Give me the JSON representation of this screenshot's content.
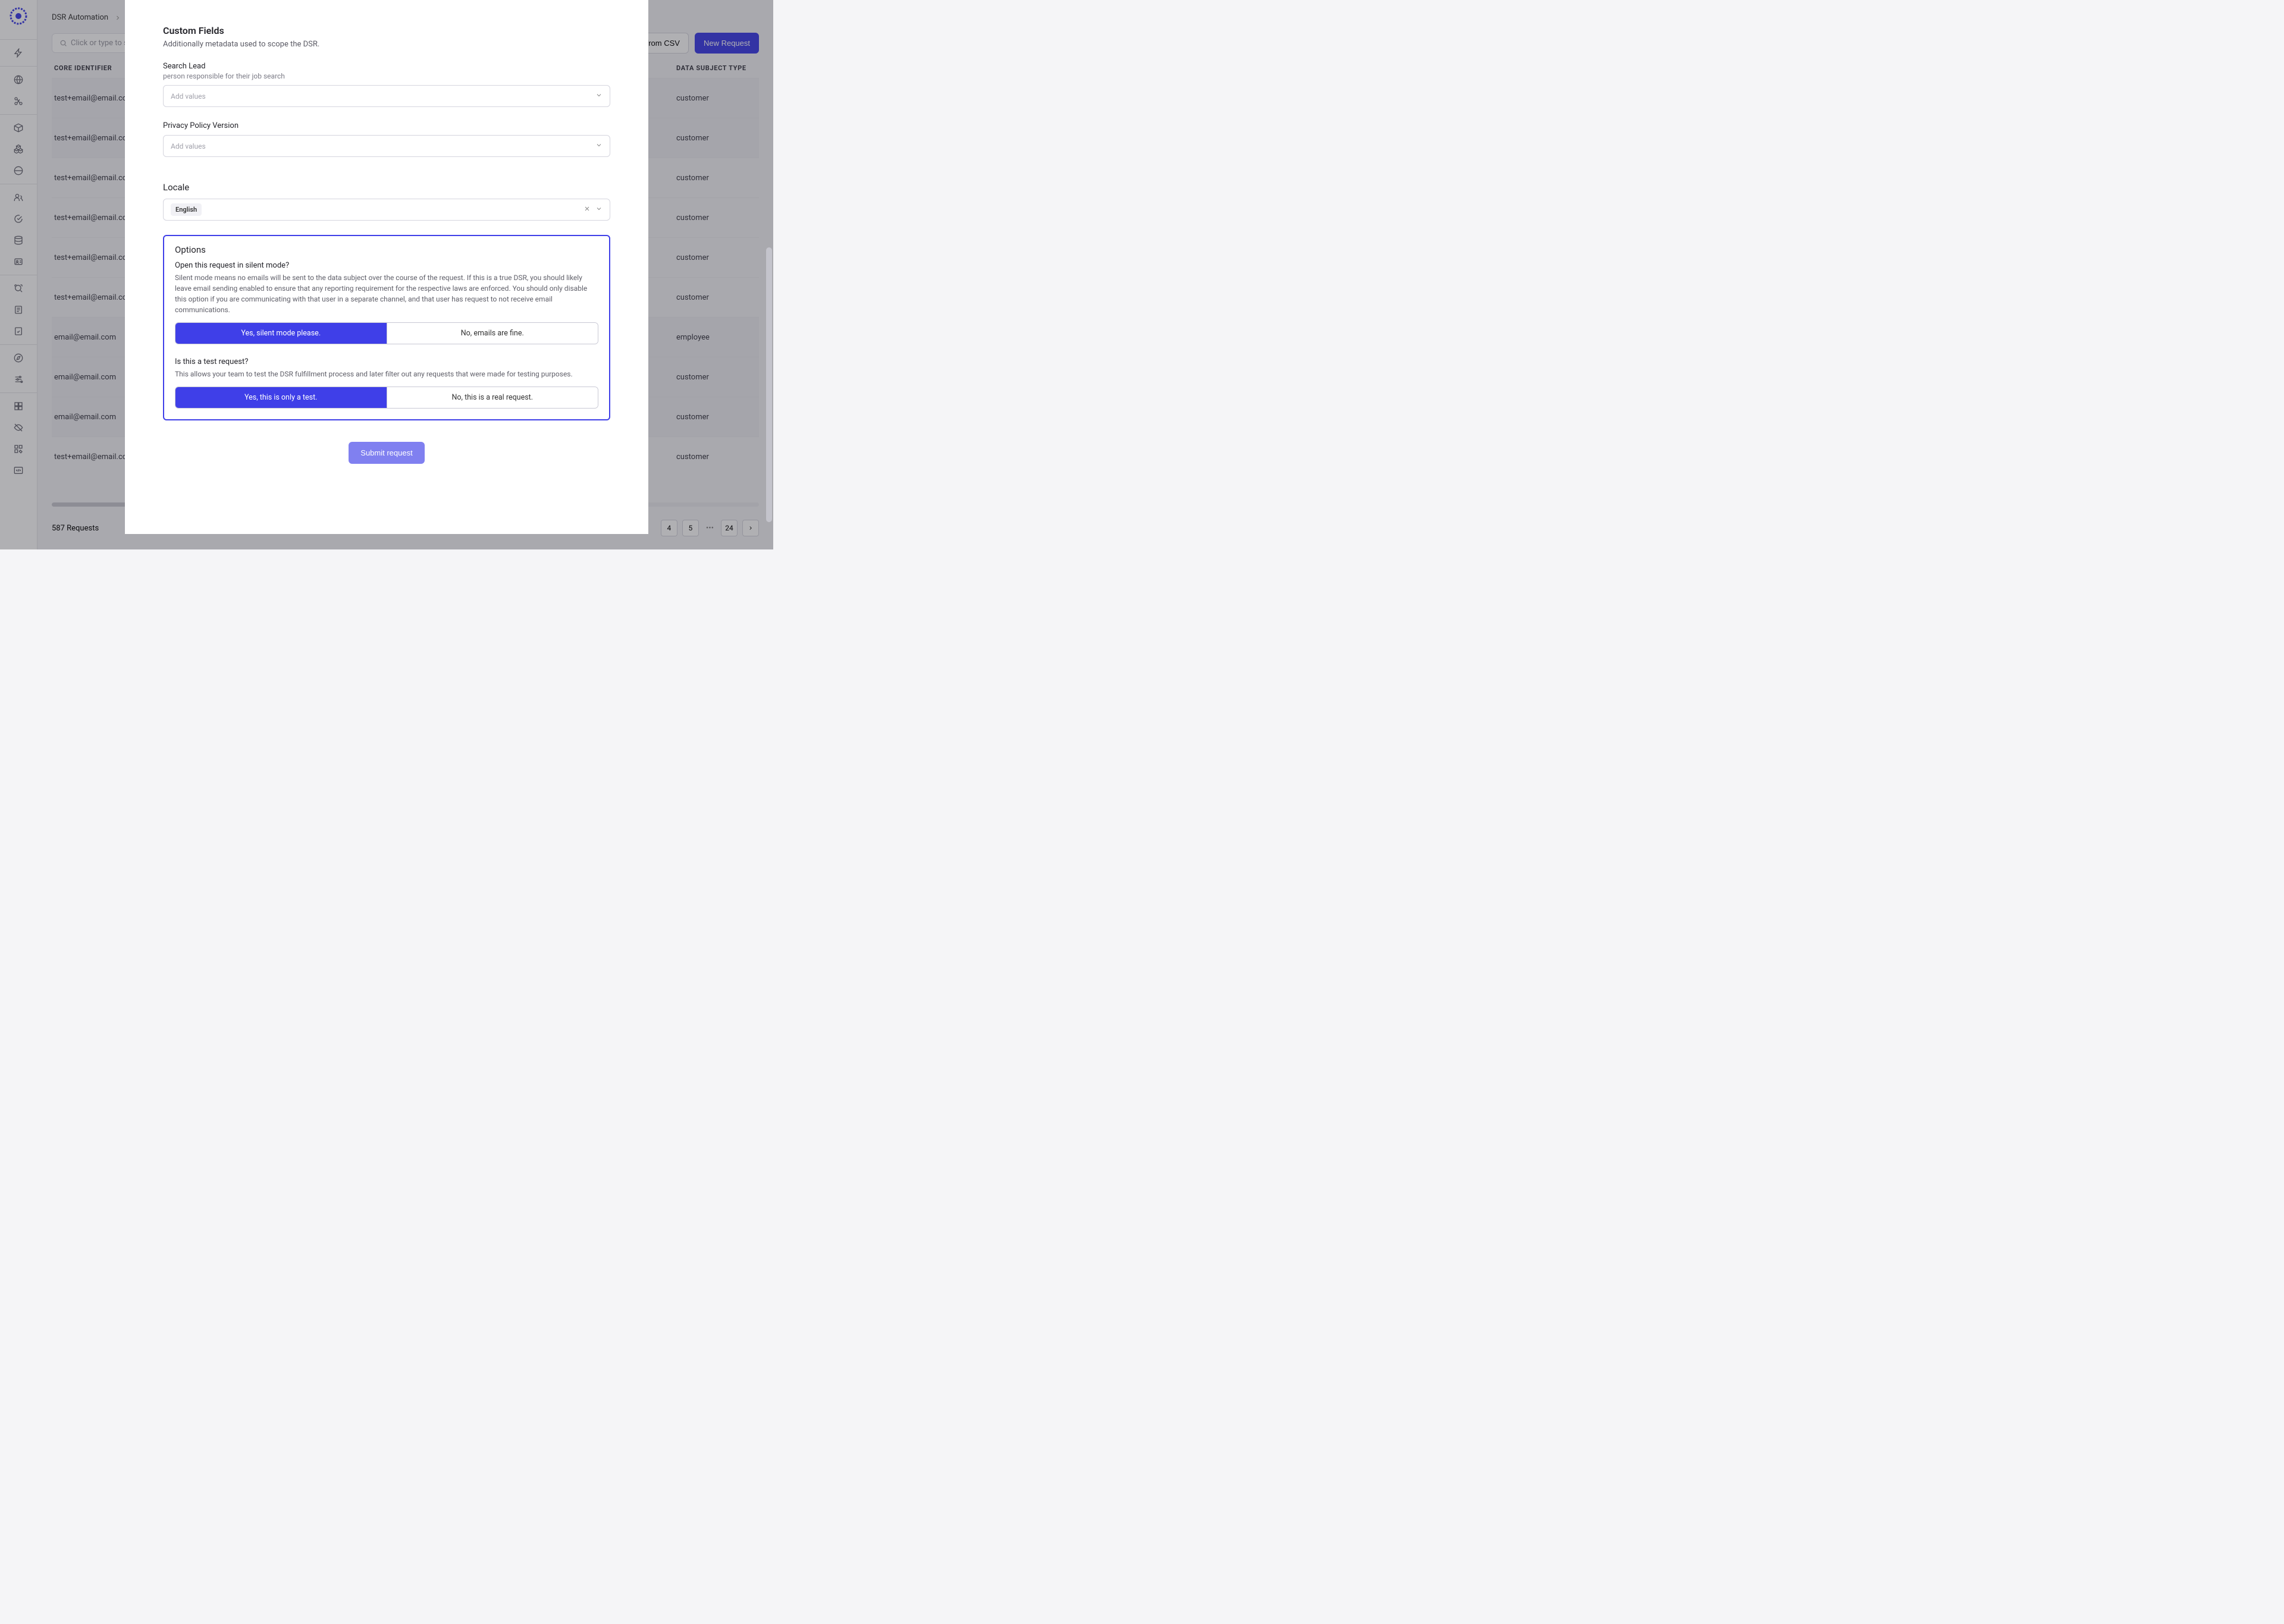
{
  "breadcrumb": {
    "root": "DSR Automation"
  },
  "topbar": {
    "search_placeholder": "Click or type to search",
    "csv_button": "sts from CSV",
    "new_button": "New Request"
  },
  "table": {
    "col_identifier": "CORE IDENTIFIER",
    "col_type": "DATA SUBJECT TYPE",
    "rows": [
      {
        "id": "test+email@email.com",
        "type": "customer",
        "sel": true
      },
      {
        "id": "test+email@email.com",
        "type": "customer",
        "sel": true
      },
      {
        "id": "test+email@email.com",
        "type": "customer",
        "sel": false
      },
      {
        "id": "test+email@email.com",
        "type": "customer",
        "sel": false
      },
      {
        "id": "test+email@email.com",
        "type": "customer",
        "sel": false
      },
      {
        "id": "test+email@email.com",
        "type": "customer",
        "sel": false
      },
      {
        "id": "email@email.com",
        "type": "employee",
        "sel": true
      },
      {
        "id": "email@email.com",
        "type": "customer",
        "sel": true
      },
      {
        "id": "email@email.com",
        "type": "customer",
        "sel": true
      },
      {
        "id": "test+email@email.com",
        "type": "customer",
        "sel": false
      }
    ]
  },
  "footer": {
    "count": "587 Requests",
    "pages": [
      "4",
      "5"
    ],
    "last_page": "24"
  },
  "modal": {
    "customFields": {
      "title": "Custom Fields",
      "sub": "Additionally metadata used to scope the DSR."
    },
    "searchLead": {
      "label": "Search Lead",
      "help": "person responsible for their job search",
      "placeholder": "Add values"
    },
    "privacyPolicy": {
      "label": "Privacy Policy Version",
      "placeholder": "Add values"
    },
    "locale": {
      "label": "Locale",
      "value": "English"
    },
    "options": {
      "title": "Options",
      "silent": {
        "question": "Open this request in silent mode?",
        "help": "Silent mode means no emails will be sent to the data subject over the course of the request. If this is a true DSR, you should likely leave email sending enabled to ensure that any reporting requirement for the respective laws are enforced. You should only disable this option if you are communicating with that user in a separate channel, and that user has request to not receive email communications.",
        "yes": "Yes, silent mode please.",
        "no": "No, emails are fine."
      },
      "test": {
        "question": "Is this a test request?",
        "help": "This allows your team to test the DSR fulfillment process and later filter out any requests that were made for testing purposes.",
        "yes": "Yes, this is only a test.",
        "no": "No, this is a real request."
      }
    },
    "submit": "Submit request"
  }
}
